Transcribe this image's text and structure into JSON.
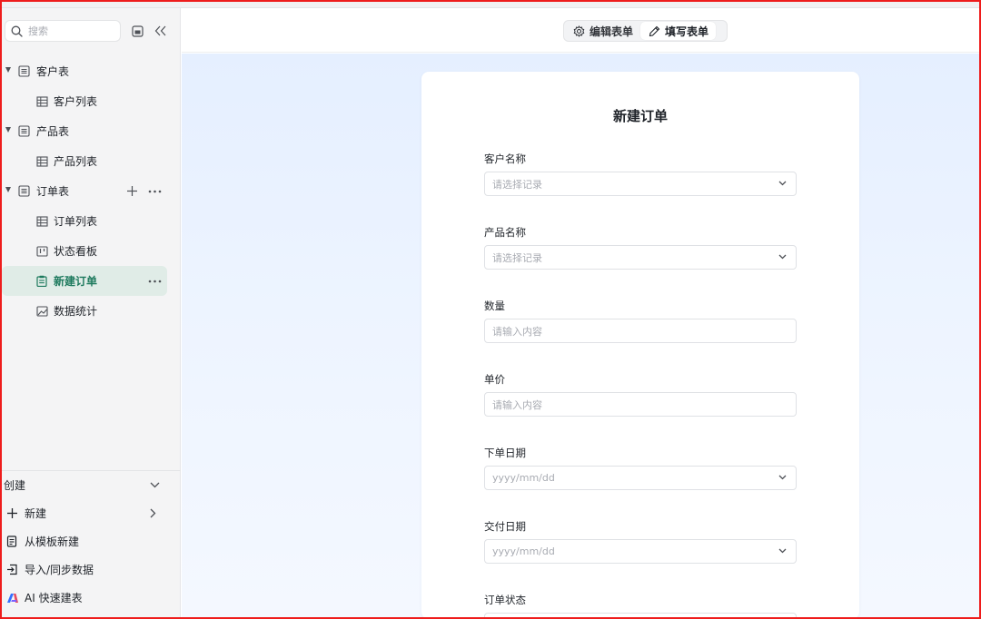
{
  "sidebar": {
    "search_placeholder": "搜索",
    "tree": [
      {
        "label": "客户表",
        "level": 1,
        "icon": "table-doc-icon",
        "expanded": true
      },
      {
        "label": "客户列表",
        "level": 2,
        "icon": "grid-view-icon"
      },
      {
        "label": "产品表",
        "level": 1,
        "icon": "table-doc-icon",
        "expanded": true
      },
      {
        "label": "产品列表",
        "level": 2,
        "icon": "grid-view-icon"
      },
      {
        "label": "订单表",
        "level": 1,
        "icon": "table-doc-icon",
        "expanded": true
      },
      {
        "label": "订单列表",
        "level": 2,
        "icon": "grid-view-icon"
      },
      {
        "label": "状态看板",
        "level": 2,
        "icon": "kanban-icon"
      },
      {
        "label": "新建订单",
        "level": 2,
        "icon": "form-icon",
        "active": true
      },
      {
        "label": "数据统计",
        "level": 2,
        "icon": "chart-image-icon"
      }
    ],
    "create": {
      "title": "创建",
      "items": [
        {
          "label": "新建",
          "icon": "plus-icon"
        },
        {
          "label": "从模板新建",
          "icon": "template-icon"
        },
        {
          "label": "导入/同步数据",
          "icon": "import-icon"
        },
        {
          "label": "AI 快速建表",
          "icon": "ai-logo-icon"
        }
      ]
    }
  },
  "header": {
    "edit_form": "编辑表单",
    "fill_form": "填写表单"
  },
  "form": {
    "title": "新建订单",
    "fields": [
      {
        "label": "客户名称",
        "placeholder": "请选择记录",
        "type": "select"
      },
      {
        "label": "产品名称",
        "placeholder": "请选择记录",
        "type": "select"
      },
      {
        "label": "数量",
        "placeholder": "请输入内容",
        "type": "input"
      },
      {
        "label": "单价",
        "placeholder": "请输入内容",
        "type": "input"
      },
      {
        "label": "下单日期",
        "placeholder": "yyyy/mm/dd",
        "type": "date"
      },
      {
        "label": "交付日期",
        "placeholder": "yyyy/mm/dd",
        "type": "date"
      },
      {
        "label": "订单状态",
        "placeholder": "",
        "type": "select"
      }
    ]
  },
  "colors": {
    "accent": "#1e7a5e",
    "active_bg": "#e0ece7",
    "frame": "#ee1c1c"
  }
}
